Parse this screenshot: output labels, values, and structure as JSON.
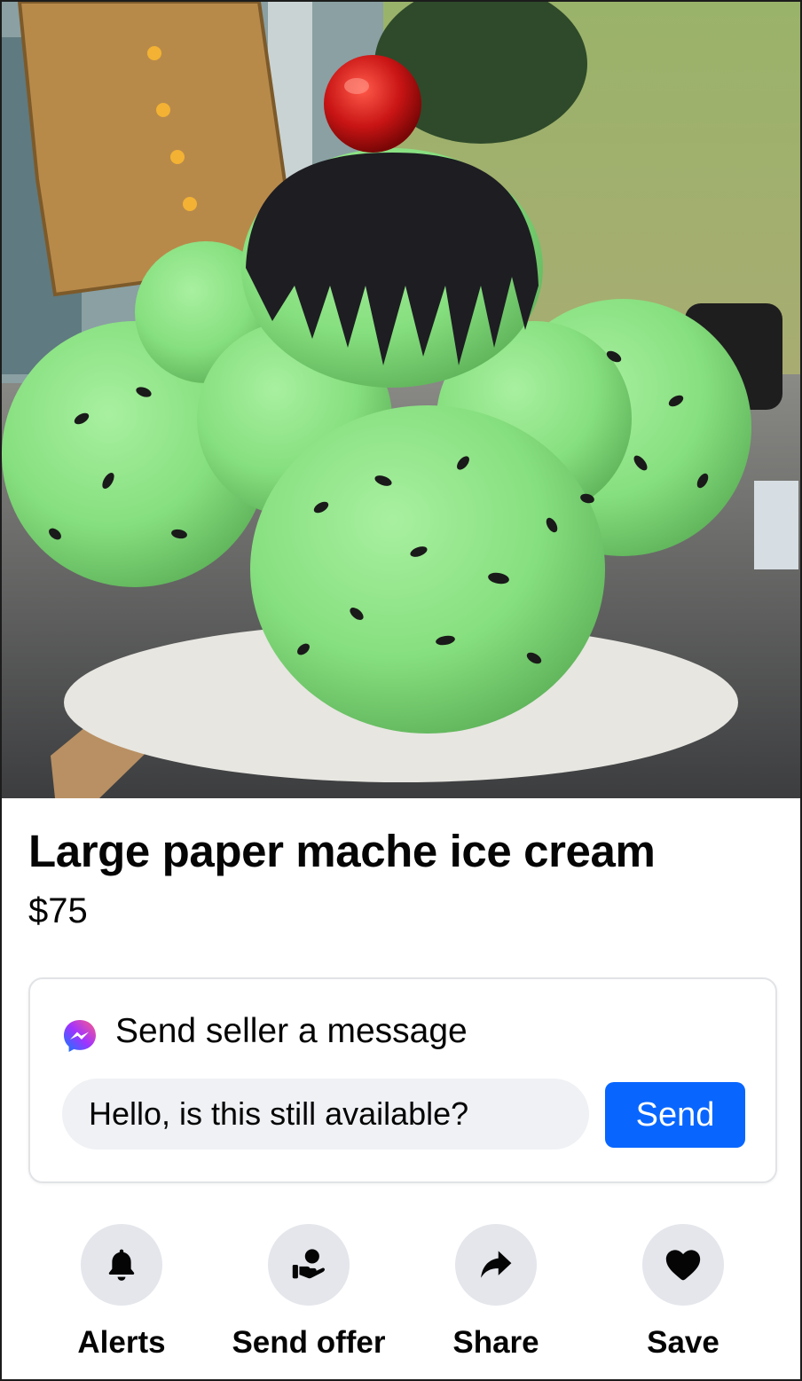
{
  "listing": {
    "photo": {
      "subject": "giant mint chocolate chip ice cream scoops sculpture with cherry"
    },
    "title": "Large paper mache ice cream",
    "price": "$75"
  },
  "message_card": {
    "icon": "messenger-icon",
    "heading": "Send seller a message",
    "input_value": "Hello, is this still available?",
    "send_label": "Send"
  },
  "actions": [
    {
      "label": "Alerts",
      "icon": "bell-icon"
    },
    {
      "label": "Send offer",
      "icon": "offer-icon"
    },
    {
      "label": "Share",
      "icon": "share-icon"
    },
    {
      "label": "Save",
      "icon": "heart-icon"
    }
  ],
  "colors": {
    "accent": "#0866ff",
    "input_bg": "#eff1f4",
    "action_circle": "#e4e6eb",
    "text": "#050505"
  }
}
